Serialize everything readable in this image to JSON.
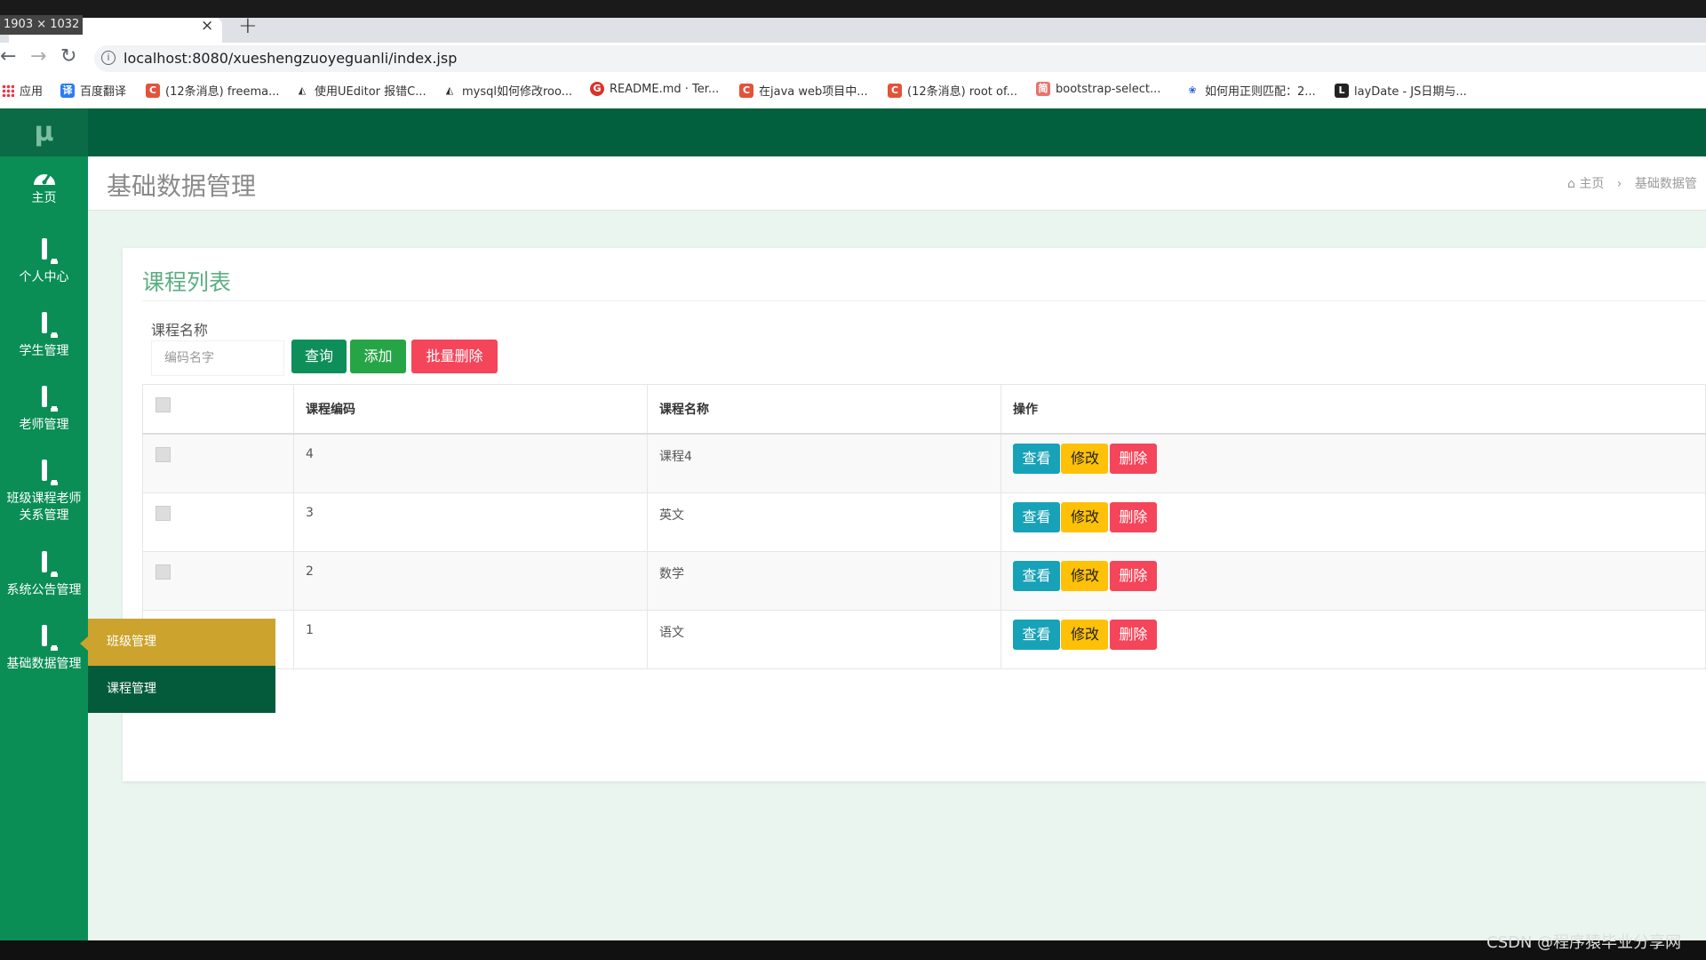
{
  "browser": {
    "dimension_label": "1903 × 1032",
    "tab_close": "×",
    "new_tab": "+",
    "url": "localhost:8080/xueshengzuoyeguanli/index.jsp",
    "bookmarks": [
      "应用",
      "百度翻译",
      "(12条消息) freema...",
      "使用UEditor 报错C...",
      "mysql如何修改roo...",
      "README.md · Ter...",
      "在java web项目中...",
      "(12条消息) root of...",
      "bootstrap-select...",
      "如何用正则匹配：2...",
      "layDate - JS日期与..."
    ]
  },
  "app": {
    "logo": "μ",
    "sidebar": [
      {
        "label": "主页"
      },
      {
        "label": "个人中心"
      },
      {
        "label": "学生管理"
      },
      {
        "label": "老师管理"
      },
      {
        "label": "班级课程老师关系管理"
      },
      {
        "label": "系统公告管理"
      },
      {
        "label": "基础数据管理"
      }
    ],
    "flyout": [
      "班级管理",
      "课程管理"
    ],
    "page_title": "基础数据管理",
    "breadcrumb": {
      "home": "主页",
      "sep": "›",
      "current": "基础数据管"
    },
    "panel": {
      "title": "课程列表",
      "filter_label": "课程名称",
      "filter_placeholder": "编码名字",
      "btn_query": "查询",
      "btn_add": "添加",
      "btn_batch_delete": "批量删除"
    },
    "table": {
      "headers": [
        "课程编码",
        "课程名称",
        "操作"
      ],
      "rows": [
        {
          "code": "4",
          "name": "课程4"
        },
        {
          "code": "3",
          "name": "英文"
        },
        {
          "code": "2",
          "name": "数学"
        },
        {
          "code": "1",
          "name": "语文"
        }
      ],
      "actions": {
        "view": "查看",
        "edit": "修改",
        "delete": "删除"
      }
    }
  },
  "watermark": "CSDN @程序猿毕业分享网"
}
